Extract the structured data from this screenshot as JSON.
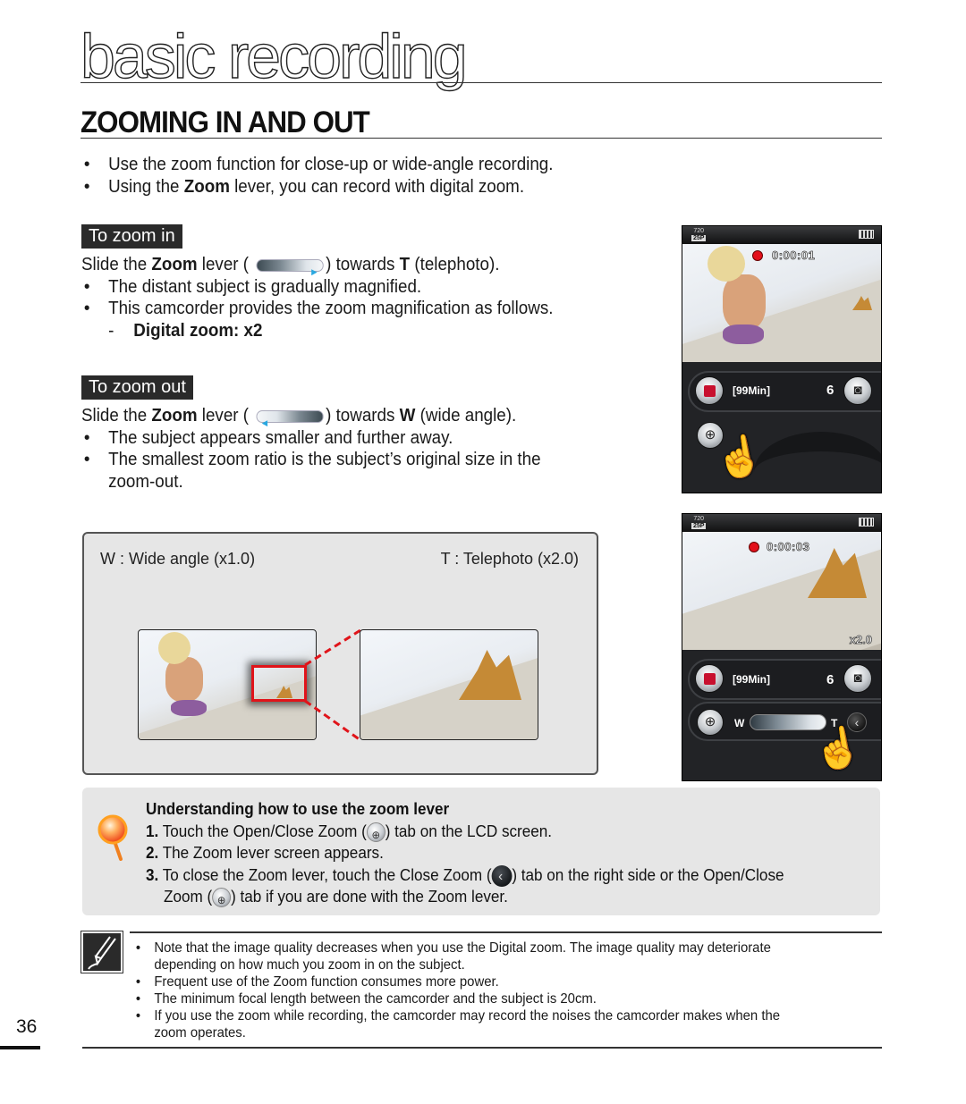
{
  "page": {
    "chapter_title": "basic recording",
    "section_title": "ZOOMING IN AND OUT",
    "page_number": "36"
  },
  "intro_bullets": [
    {
      "pre": "Use the zoom function for close-up or wide-angle recording.",
      "bold": "",
      "post": ""
    },
    {
      "pre": "Using the ",
      "bold": "Zoom",
      "post": " lever, you can record with digital zoom."
    }
  ],
  "zoom_in": {
    "label": "To zoom in",
    "instruction": {
      "pre": "Slide the ",
      "bold": "Zoom",
      "mid": " lever ( ",
      "post": ") towards ",
      "bold2": "T",
      "end": " (telephoto)."
    },
    "bullets": [
      "The distant subject is gradually magnified.",
      "This camcorder provides the zoom magnification as follows."
    ],
    "sub_item": {
      "dash": "-",
      "text": "Digital zoom: x2"
    }
  },
  "zoom_out": {
    "label": "To zoom out",
    "instruction": {
      "pre": "Slide the ",
      "bold": "Zoom",
      "mid": " lever ( ",
      "post": ") towards ",
      "bold2": "W",
      "end": " (wide angle)."
    },
    "bullets": [
      "The subject appears smaller and further away.",
      "The smallest zoom ratio is the subject’s original size in the",
      "zoom-out."
    ]
  },
  "illustration": {
    "wide_label": "W : Wide angle (x1.0)",
    "tele_label": "T : Telephoto (x2.0)",
    "highlight_color": "#e0141a"
  },
  "camcorder_screens": [
    {
      "resolution": "720",
      "frame_rate": "25P",
      "timecode": "0:00:01",
      "remaining": "[99Min]",
      "photo_count": "6",
      "zoom_ratio": "",
      "lever_visible": false
    },
    {
      "resolution": "720",
      "frame_rate": "25P",
      "timecode": "0:00:03",
      "remaining": "[99Min]",
      "photo_count": "6",
      "zoom_ratio": "x2.0",
      "lever_visible": true,
      "lever_w_label": "W",
      "lever_t_label": "T",
      "lever_position": 0.9
    }
  ],
  "tip": {
    "title": "Understanding how to use the zoom lever",
    "steps": [
      {
        "num": "1.",
        "pre": " Touch the Open/Close Zoom (",
        "post": ") tab on the LCD screen."
      },
      {
        "num": "2.",
        "pre": " The Zoom lever screen appears.",
        "post": ""
      },
      {
        "num": "3.",
        "pre": " To close the Zoom lever, touch the Close Zoom (",
        "mid": ") tab on the right side or the Open/Close",
        "cont_pre": "Zoom (",
        "post": ") tab if you are done with the Zoom lever."
      }
    ]
  },
  "notes": [
    "Note that the image quality decreases when you use the Digital zoom. The image quality may deteriorate",
    "depending on how much you zoom in on the subject.",
    "Frequent use of the Zoom function consumes more power.",
    "The minimum focal length between the camcorder and the subject is 20cm.",
    "If you use the zoom while recording, the camcorder may record the noises the camcorder makes when the",
    "zoom operates."
  ]
}
